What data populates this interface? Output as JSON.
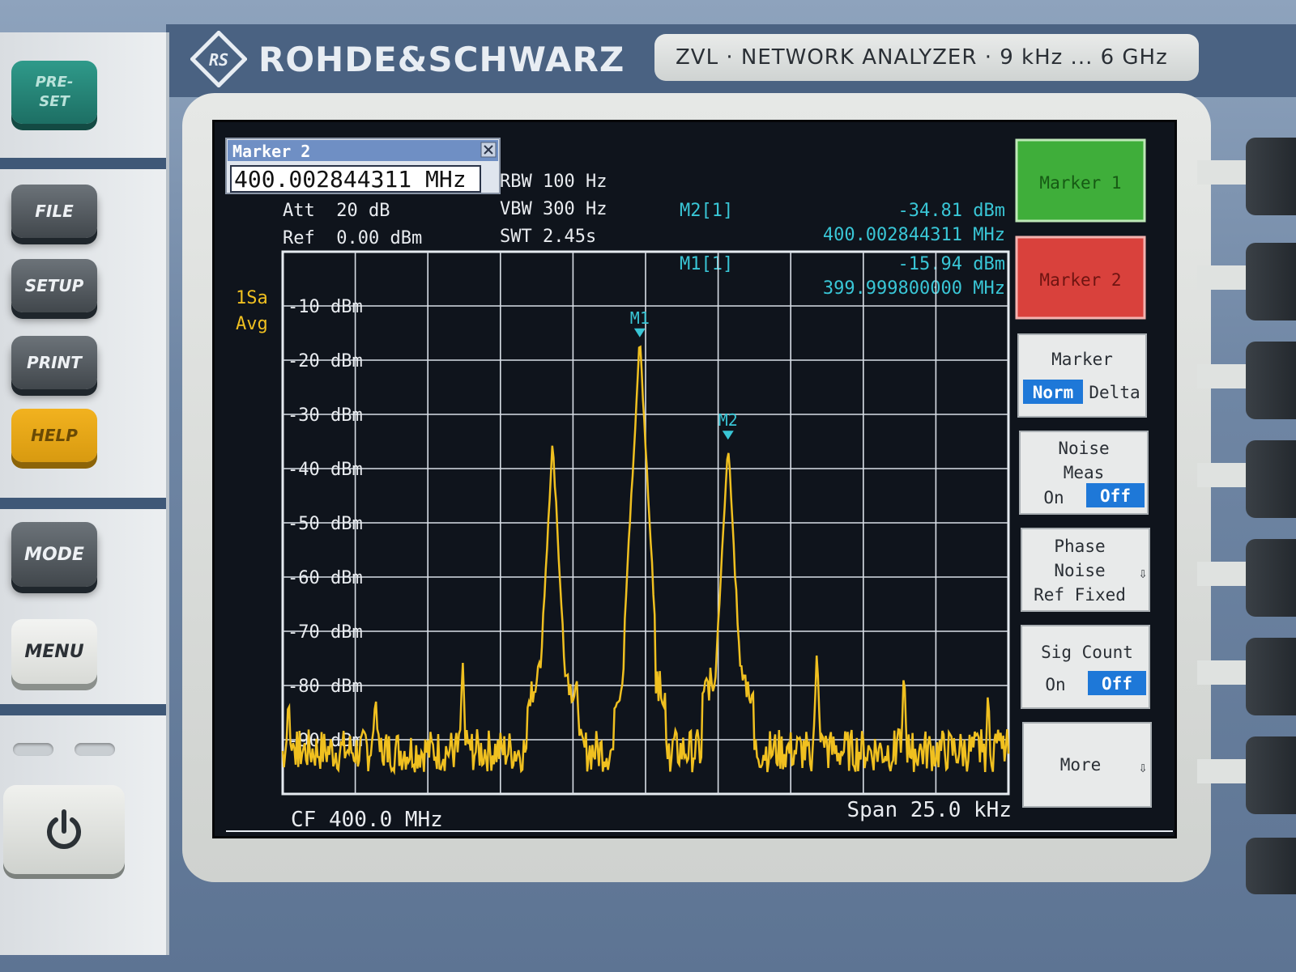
{
  "device": {
    "brand": "ROHDE&SCHWARZ",
    "model_plate": "ZVL · NETWORK ANALYZER · 9 kHz ... 6 GHz"
  },
  "hardware_keys": {
    "preset": "PRE-\nSET",
    "file": "FILE",
    "setup": "SETUP",
    "print": "PRINT",
    "help": "HELP",
    "mode": "MODE",
    "menu": "MENU"
  },
  "marker_dialog": {
    "title": "Marker 2",
    "input_value": "400.002844311 MHz"
  },
  "settings": {
    "rbw": "RBW 100 Hz",
    "vbw": "VBW 300 Hz",
    "swt": "SWT 2.45s",
    "att": "Att  20 dB",
    "ref": "Ref  0.00 dBm",
    "trace_mode_1": "1Sa",
    "trace_mode_2": "Avg"
  },
  "readouts": {
    "m2_label": "M2[1]",
    "m2_level": "-34.81 dBm",
    "m2_freq": "400.002844311 MHz",
    "m1_label": "M1[1]",
    "m1_level": "-15.94 dBm",
    "m1_freq": "399.999800000 MHz"
  },
  "footer": {
    "center_freq": "CF 400.0 MHz",
    "span": "Span 25.0 kHz"
  },
  "softkeys": {
    "marker1": "Marker 1",
    "marker2": "Marker 2",
    "marker_mode_title": "Marker",
    "marker_mode_norm": "Norm",
    "marker_mode_delta": "Delta",
    "noise_meas_line1": "Noise",
    "noise_meas_line2": "Meas",
    "noise_on": "On",
    "noise_off": "Off",
    "phase_line1": "Phase",
    "phase_line2": "Noise",
    "phase_line3": "Ref Fixed",
    "sig_count": "Sig Count",
    "sig_on": "On",
    "sig_off": "Off",
    "more": "More",
    "arrow": "⇩"
  },
  "colors": {
    "trace": "#f0c020",
    "marker": "#39c6d6",
    "grid": "#d8dee6",
    "marker1_key": "#3fae3a",
    "marker2_key": "#d9413c",
    "toggle_on": "#1e78d8"
  },
  "chart_data": {
    "type": "line",
    "title": "",
    "xlabel": "",
    "ylabel": "",
    "x_unit": "kHz offset from CF",
    "xlim": [
      -12.5,
      12.5
    ],
    "ylim": [
      -100,
      0
    ],
    "y_ticks": [
      "-10 dBm",
      "-20 dBm",
      "-30 dBm",
      "-40 dBm",
      "-50 dBm",
      "-60 dBm",
      "-70 dBm",
      "-80 dBm",
      "-90 dBm"
    ],
    "grid": true,
    "noise_floor_dbm": -92,
    "peaks": [
      {
        "x": -12.3,
        "y": -81
      },
      {
        "x": -9.3,
        "y": -80
      },
      {
        "x": -6.3,
        "y": -76
      },
      {
        "x": -3.2,
        "y": -35
      },
      {
        "x": -0.2,
        "y": -15.94
      },
      {
        "x": 0.6,
        "y": -84
      },
      {
        "x": 2.84,
        "y": -34.81
      },
      {
        "x": 5.9,
        "y": -73
      },
      {
        "x": 8.9,
        "y": -77
      },
      {
        "x": 11.8,
        "y": -81
      }
    ],
    "markers": [
      {
        "label": "M1",
        "x": -0.2,
        "y": -15.94
      },
      {
        "label": "M2",
        "x": 2.84,
        "y": -34.81
      }
    ]
  }
}
